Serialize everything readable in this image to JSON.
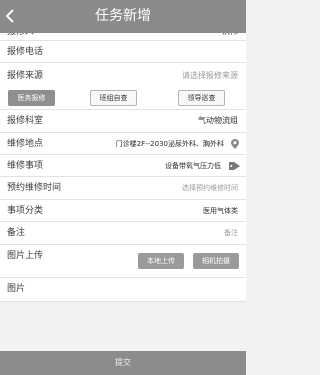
{
  "header": {
    "title": "任务新增",
    "back_icon": "chevron-left-icon"
  },
  "form": {
    "reporter": {
      "label": "报修人",
      "value": "洪伟"
    },
    "reporter_phone": {
      "label": "报修电话",
      "value": ""
    },
    "source": {
      "label": "报修来源",
      "placeholder": "请选择报修来源",
      "options": [
        "医务报修",
        "班组自查",
        "领导巡查"
      ],
      "selected": "医务报修"
    },
    "department": {
      "label": "报修科室",
      "value": "气动物流组"
    },
    "location": {
      "label": "维修地点",
      "value": "门诊楼2F--2030泌尿外科、胸外科",
      "icon": "location-pin-icon"
    },
    "item": {
      "label": "维修事项",
      "value": "设备带氧气压力低",
      "icon": "tag-icon"
    },
    "scheduled_time": {
      "label": "预约维修时间",
      "placeholder": "选择预约维修时间"
    },
    "category": {
      "label": "事项分类",
      "value": "医用气体类"
    },
    "remarks": {
      "label": "备注",
      "placeholder": "备注"
    },
    "image_upload": {
      "label": "图片上传",
      "local_upload_label": "本地上传",
      "camera_label": "相机拍摄"
    },
    "images": {
      "label": "图片"
    }
  },
  "footer": {
    "submit_label": "提交"
  },
  "colors": {
    "header_bg": "#8a8a8a",
    "footer_bg": "#8c8c8c",
    "active_button_bg": "#8f8f8f"
  }
}
